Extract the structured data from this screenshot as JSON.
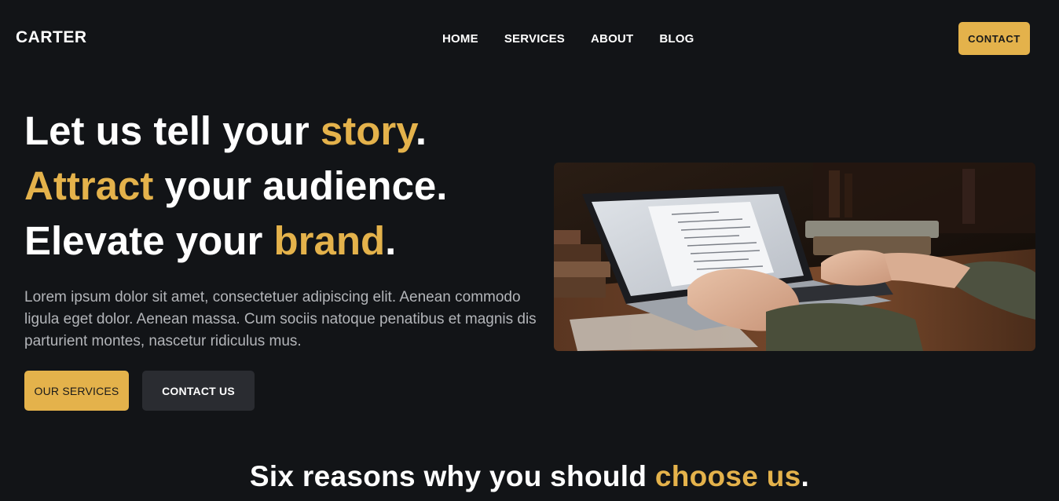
{
  "header": {
    "logo": "CARTER",
    "nav": [
      "HOME",
      "SERVICES",
      "ABOUT",
      "BLOG"
    ],
    "contact_label": "CONTACT"
  },
  "hero": {
    "line1": {
      "pre": "Let us tell your ",
      "accent": "story",
      "post": "."
    },
    "line2": {
      "accent": "Attract",
      "post": " your audience."
    },
    "line3": {
      "pre": "Elevate your ",
      "accent": "brand",
      "post": "."
    },
    "description": "Lorem ipsum dolor sit amet, consectetuer adipiscing elit. Aenean commodo ligula eget dolor. Aenean massa. Cum sociis natoque penatibus et magnis dis parturient montes, nascetur ridiculus mus.",
    "primary_button": "OUR SERVICES",
    "secondary_button": "CONTACT US"
  },
  "section": {
    "title": {
      "pre": "Six reasons why you should ",
      "accent": "choose us",
      "post": "."
    }
  },
  "colors": {
    "background": "#121417",
    "accent": "#e4b24b",
    "secondary_button": "#2a2c31",
    "body_text": "#b3b5b9"
  }
}
